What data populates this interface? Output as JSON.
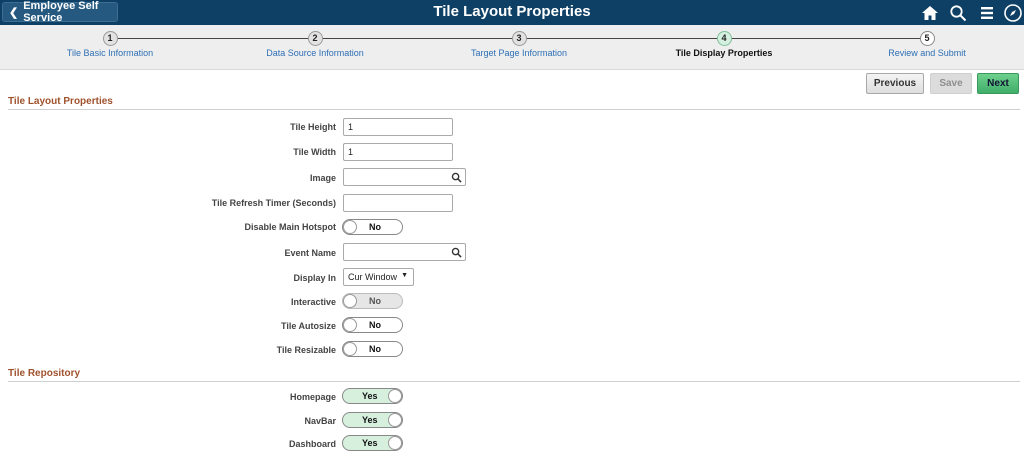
{
  "header": {
    "back_label": "Employee Self Service",
    "title": "Tile Layout Properties",
    "icons": [
      "home-icon",
      "search-icon",
      "menu-icon",
      "navbar-compass-icon"
    ]
  },
  "train": {
    "steps": [
      {
        "number": "1",
        "label": "Tile Basic Information"
      },
      {
        "number": "2",
        "label": "Data Source Information"
      },
      {
        "number": "3",
        "label": "Target Page Information"
      },
      {
        "number": "4",
        "label": "Tile Display Properties"
      },
      {
        "number": "5",
        "label": "Review and Submit"
      }
    ],
    "active_step": 4
  },
  "buttons": {
    "previous": "Previous",
    "save": "Save",
    "next": "Next"
  },
  "layout_section": {
    "title": "Tile Layout Properties",
    "tile_height": {
      "label": "Tile Height",
      "value": "1"
    },
    "tile_width": {
      "label": "Tile Width",
      "value": "1"
    },
    "image": {
      "label": "Image",
      "value": ""
    },
    "refresh_timer": {
      "label": "Tile Refresh Timer (Seconds)",
      "value": ""
    },
    "disable_hotspot": {
      "label": "Disable Main Hotspot",
      "state": "No"
    },
    "event_name": {
      "label": "Event Name",
      "value": ""
    },
    "display_in": {
      "label": "Display In",
      "value": "Cur Window"
    },
    "interactive": {
      "label": "Interactive",
      "state": "No"
    },
    "autosize": {
      "label": "Tile Autosize",
      "state": "No"
    },
    "resizable": {
      "label": "Tile Resizable",
      "state": "No"
    }
  },
  "repository_section": {
    "title": "Tile Repository",
    "homepage": {
      "label": "Homepage",
      "state": "Yes"
    },
    "navbar": {
      "label": "NavBar",
      "state": "Yes"
    },
    "dashboard": {
      "label": "Dashboard",
      "state": "Yes"
    }
  },
  "colors": {
    "header_bg": "#0e4066",
    "accent_green": "#3fae68",
    "section_title": "#a0522d",
    "link_blue": "#2e6fb5"
  }
}
